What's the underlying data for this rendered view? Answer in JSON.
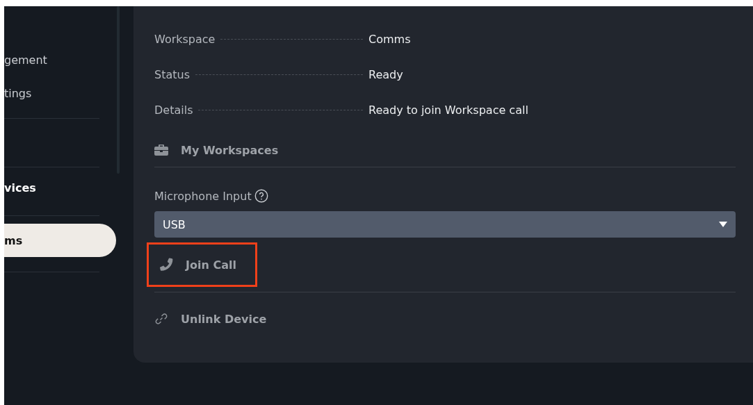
{
  "sidebar": {
    "items": [
      {
        "label": "gement",
        "kind": "link",
        "selected": false
      },
      {
        "label": "tings",
        "kind": "link",
        "selected": false
      },
      {
        "kind": "divider"
      },
      {
        "kind": "spacer"
      },
      {
        "kind": "divider"
      },
      {
        "label": "vices",
        "kind": "heading"
      },
      {
        "kind": "divider"
      },
      {
        "label": "ms",
        "kind": "link",
        "selected": true
      },
      {
        "kind": "divider"
      }
    ]
  },
  "details": [
    {
      "label": "Workspace",
      "value": "Comms"
    },
    {
      "label": "Status",
      "value": "Ready"
    },
    {
      "label": "Details",
      "value": "Ready to join Workspace call"
    }
  ],
  "my_workspaces": {
    "label": "My Workspaces"
  },
  "microphone_input": {
    "label": "Microphone Input",
    "value": "USB"
  },
  "join_call": {
    "label": "Join Call",
    "highlighted": true
  },
  "unlink_device": {
    "label": "Unlink Device"
  }
}
